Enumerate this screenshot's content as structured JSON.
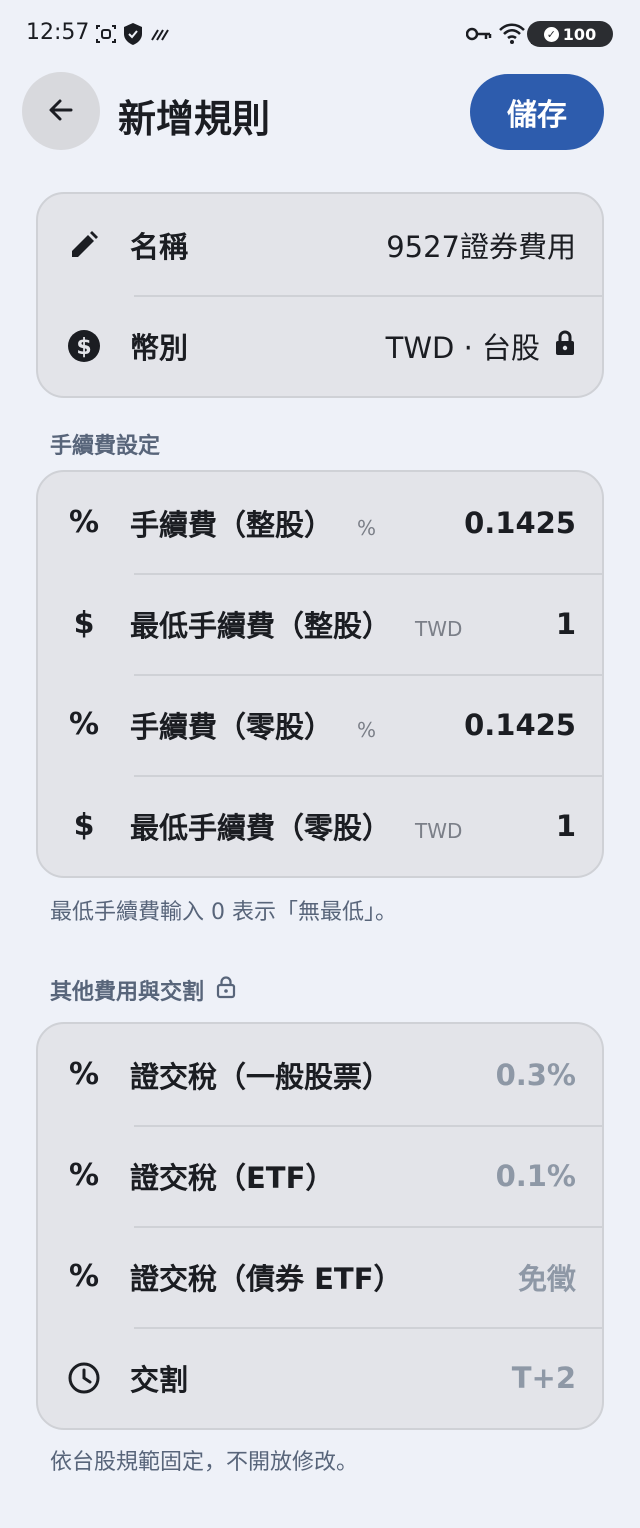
{
  "status_bar": {
    "time": "12:57",
    "battery": "100",
    "icons": [
      "screenshot-icon",
      "shield-icon",
      "data-icon",
      "key-icon",
      "wifi-icon",
      "signal-icon"
    ]
  },
  "header": {
    "title": "新增規則",
    "save_label": "儲存",
    "back_icon": "arrow-left-icon"
  },
  "basic": {
    "name_label": "名稱",
    "name_value": "9527證券費用",
    "currency_label": "幣別",
    "currency_value": "TWD · 台股"
  },
  "fees": {
    "section_title": "手續費設定",
    "rows": [
      {
        "label": "手續費（整股）",
        "unit": "%",
        "value": "0.1425",
        "icon": "percent-icon"
      },
      {
        "label": "最低手續費（整股）",
        "unit": "TWD",
        "value": "1",
        "icon": "dollar-icon"
      },
      {
        "label": "手續費（零股）",
        "unit": "%",
        "value": "0.1425",
        "icon": "percent-icon"
      },
      {
        "label": "最低手續費（零股）",
        "unit": "TWD",
        "value": "1",
        "icon": "dollar-icon"
      }
    ],
    "note": "最低手續費輸入 0 表示「無最低」。"
  },
  "other": {
    "section_title": "其他費用與交割",
    "rows": [
      {
        "label": "證交稅（一般股票）",
        "value": "0.3%",
        "icon": "percent-icon"
      },
      {
        "label": "證交稅（ETF）",
        "value": "0.1%",
        "icon": "percent-icon"
      },
      {
        "label": "證交稅（債券 ETF）",
        "value": "免徵",
        "icon": "percent-icon"
      },
      {
        "label": "交割",
        "value": "T+2",
        "icon": "clock-icon"
      }
    ],
    "note": "依台股規範固定，不開放修改。"
  },
  "colors": {
    "background": "#eef1f8",
    "card": "#e3e4e9",
    "accent": "#2d5cad",
    "muted_text": "#8e98a6",
    "section_text": "#58657a"
  }
}
